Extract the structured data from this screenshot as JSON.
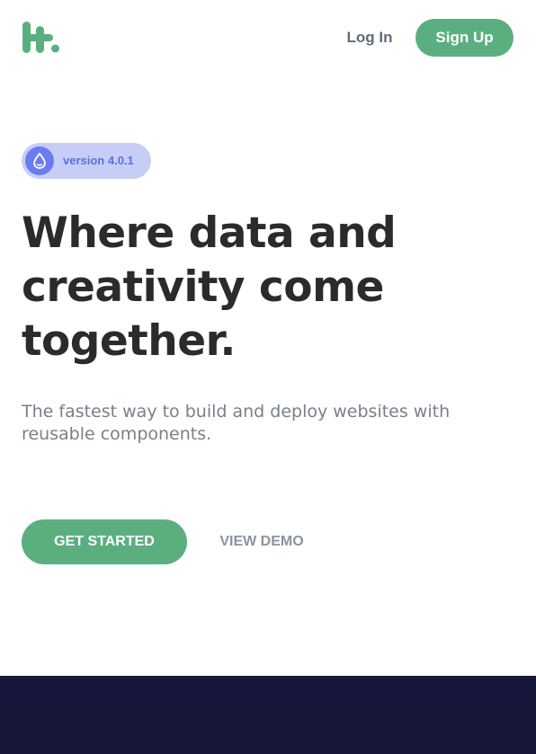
{
  "header": {
    "logo_icon": "brand-logo-icon",
    "login_label": "Log In",
    "signup_label": "Sign Up"
  },
  "hero": {
    "badge": {
      "icon": "droplet-icon",
      "label": "version 4.0.1"
    },
    "headline_lines": [
      "Where data and",
      "creativity come",
      "together."
    ],
    "subtitle_lines": [
      "The fastest way to build and deploy websites with",
      "reusable components."
    ],
    "primary_cta": "GET STARTED",
    "secondary_cta": "VIEW DEMO"
  },
  "colors": {
    "brand_green": "#5baf7f",
    "badge_bg": "#c6cef8",
    "badge_accent": "#6a7cf0",
    "headline": "#2b2b2b",
    "muted_text": "#77808a",
    "footer_band": "#18163b"
  }
}
